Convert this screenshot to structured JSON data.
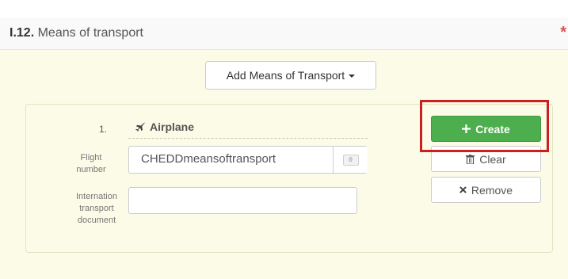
{
  "section": {
    "number": "I.12.",
    "title": "Means of transport",
    "required_mark": "*"
  },
  "add_button": {
    "label": "Add Means of Transport"
  },
  "item": {
    "number": "1.",
    "type": "Airplane",
    "icon": "airplane-icon"
  },
  "fields": {
    "flight_number": {
      "label_line1": "Flight",
      "label_line2": "number",
      "value": "CHEDDmeansoftransport"
    },
    "itd": {
      "label_line1": "Internation",
      "label_line2": "transport",
      "label_line3": "document",
      "value": ""
    }
  },
  "actions": {
    "create": {
      "label": "Create",
      "icon": "plus-icon"
    },
    "clear": {
      "label": "Clear",
      "icon": "trash-icon"
    },
    "remove": {
      "label": "Remove",
      "icon": "times-icon"
    }
  },
  "colors": {
    "create_green": "#4cae4c",
    "highlight_red": "#cc1f1f",
    "body_background": "#fbfbe8"
  }
}
